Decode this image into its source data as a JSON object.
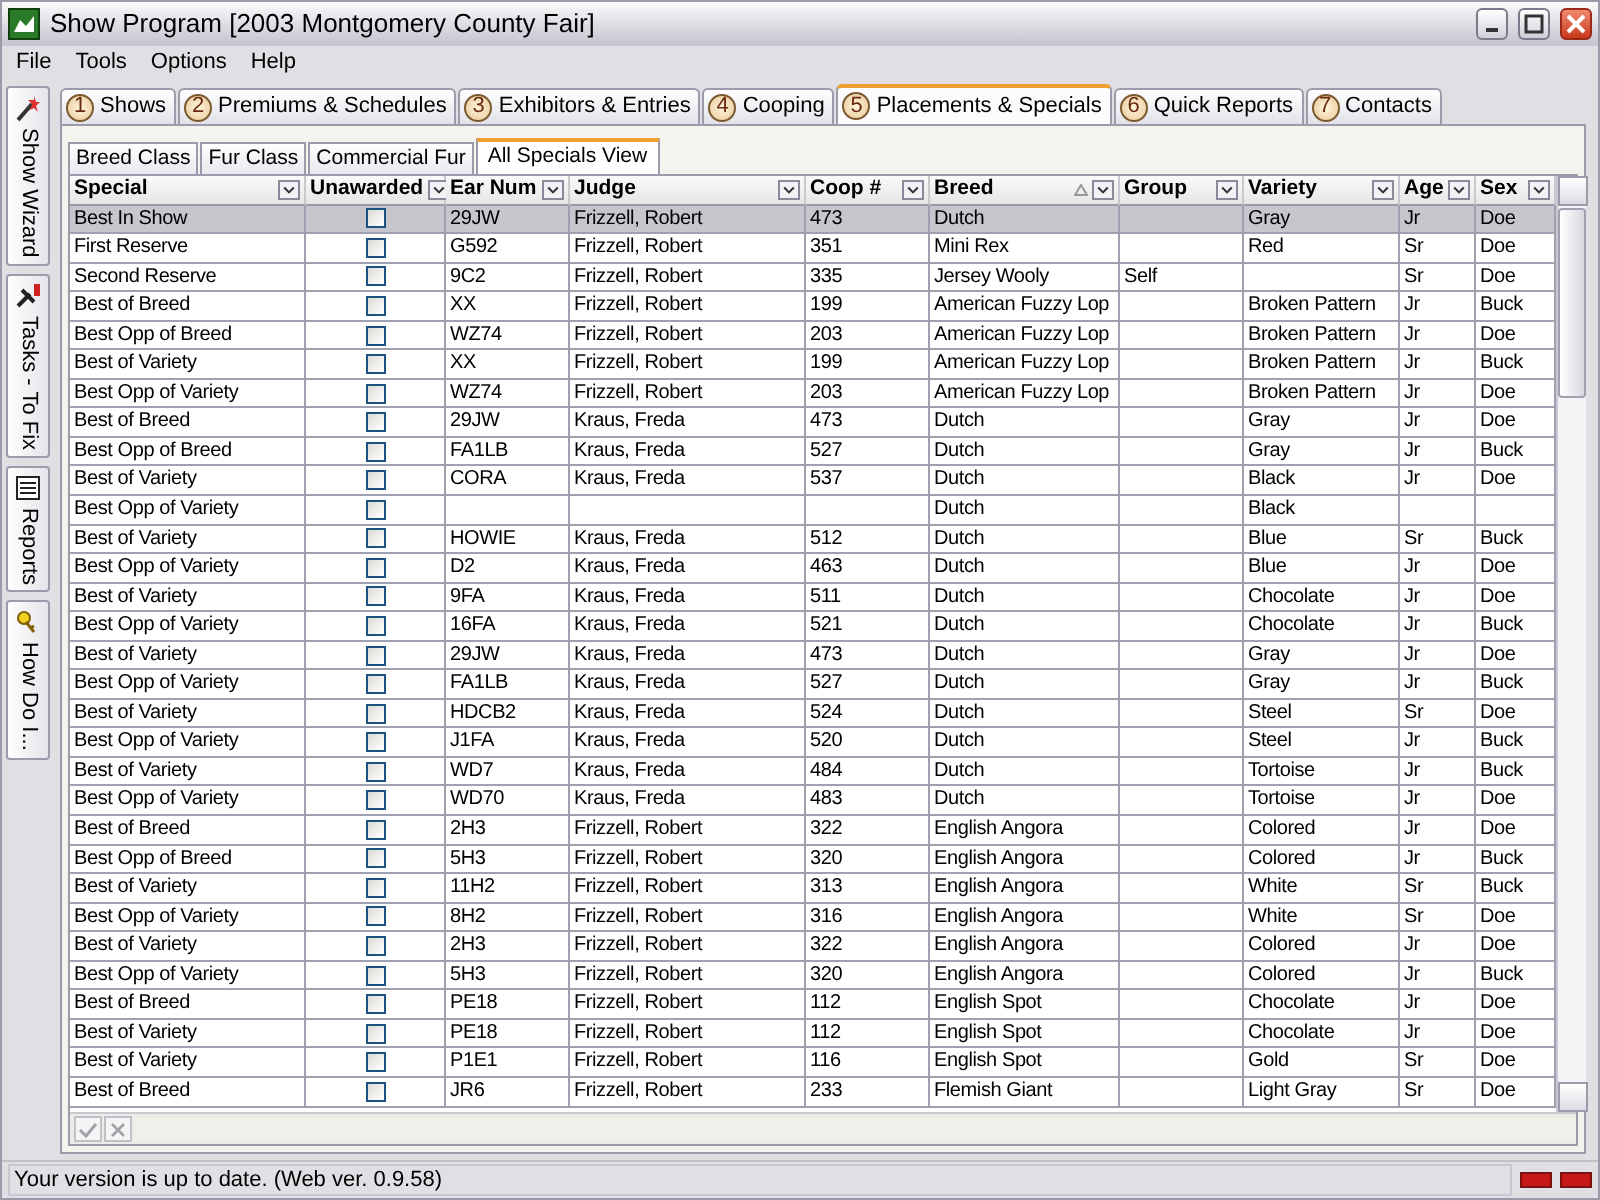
{
  "window": {
    "title": "Show Program [2003 Montgomery County Fair]"
  },
  "menu": [
    "File",
    "Tools",
    "Options",
    "Help"
  ],
  "sidebar": {
    "items": [
      {
        "label": "Show Wizard"
      },
      {
        "label": "Tasks - To Fix"
      },
      {
        "label": "Reports"
      },
      {
        "label": "How Do I..."
      }
    ]
  },
  "tabs": [
    {
      "number": "1",
      "label": "Shows",
      "selected": false
    },
    {
      "number": "2",
      "label": "Premiums & Schedules",
      "selected": false
    },
    {
      "number": "3",
      "label": "Exhibitors & Entries",
      "selected": false
    },
    {
      "number": "4",
      "label": "Cooping",
      "selected": false
    },
    {
      "number": "5",
      "label": "Placements & Specials",
      "selected": true
    },
    {
      "number": "6",
      "label": "Quick Reports",
      "selected": false
    },
    {
      "number": "7",
      "label": "Contacts",
      "selected": false
    }
  ],
  "subtabs": [
    {
      "label": "Breed Class",
      "selected": false
    },
    {
      "label": "Fur Class",
      "selected": false
    },
    {
      "label": "Commercial Fur",
      "selected": false
    },
    {
      "label": "All Specials View",
      "selected": true
    }
  ],
  "table": {
    "columns": [
      {
        "label": "Special",
        "sorted": false
      },
      {
        "label": "Unawarded",
        "sorted": false
      },
      {
        "label": "Ear Num",
        "sorted": false
      },
      {
        "label": "Judge",
        "sorted": false
      },
      {
        "label": "Coop #",
        "sorted": false
      },
      {
        "label": "Breed",
        "sorted": true
      },
      {
        "label": "Group",
        "sorted": false
      },
      {
        "label": "Variety",
        "sorted": false
      },
      {
        "label": "Age",
        "sorted": false
      },
      {
        "label": "Sex",
        "sorted": false
      }
    ],
    "rows": [
      {
        "selected": true,
        "unawarded": false,
        "cells": [
          "Best In Show",
          "",
          "29JW",
          "Frizzell, Robert",
          "473",
          "Dutch",
          "",
          "Gray",
          "Jr",
          "Doe"
        ]
      },
      {
        "selected": false,
        "unawarded": false,
        "cells": [
          "First Reserve",
          "",
          "G592",
          "Frizzell, Robert",
          "351",
          "Mini Rex",
          "",
          "Red",
          "Sr",
          "Doe"
        ]
      },
      {
        "selected": false,
        "unawarded": false,
        "cells": [
          "Second Reserve",
          "",
          "9C2",
          "Frizzell, Robert",
          "335",
          "Jersey Wooly",
          "Self",
          "",
          "Sr",
          "Doe"
        ]
      },
      {
        "selected": false,
        "unawarded": false,
        "cells": [
          "Best of Breed",
          "",
          "XX",
          "Frizzell, Robert",
          "199",
          "American Fuzzy Lop",
          "",
          "Broken Pattern",
          "Jr",
          "Buck"
        ]
      },
      {
        "selected": false,
        "unawarded": false,
        "cells": [
          "Best Opp of Breed",
          "",
          "WZ74",
          "Frizzell, Robert",
          "203",
          "American Fuzzy Lop",
          "",
          "Broken Pattern",
          "Jr",
          "Doe"
        ]
      },
      {
        "selected": false,
        "unawarded": false,
        "cells": [
          "Best of Variety",
          "",
          "XX",
          "Frizzell, Robert",
          "199",
          "American Fuzzy Lop",
          "",
          "Broken Pattern",
          "Jr",
          "Buck"
        ]
      },
      {
        "selected": false,
        "unawarded": false,
        "cells": [
          "Best Opp of Variety",
          "",
          "WZ74",
          "Frizzell, Robert",
          "203",
          "American Fuzzy Lop",
          "",
          "Broken Pattern",
          "Jr",
          "Doe"
        ]
      },
      {
        "selected": false,
        "unawarded": false,
        "cells": [
          "Best of Breed",
          "",
          "29JW",
          "Kraus, Freda",
          "473",
          "Dutch",
          "",
          "Gray",
          "Jr",
          "Doe"
        ]
      },
      {
        "selected": false,
        "unawarded": false,
        "cells": [
          "Best Opp of Breed",
          "",
          "FA1LB",
          "Kraus, Freda",
          "527",
          "Dutch",
          "",
          "Gray",
          "Jr",
          "Buck"
        ]
      },
      {
        "selected": false,
        "unawarded": false,
        "cells": [
          "Best of Variety",
          "",
          "CORA",
          "Kraus, Freda",
          "537",
          "Dutch",
          "",
          "Black",
          "Jr",
          "Doe"
        ]
      },
      {
        "selected": false,
        "unawarded": false,
        "cells": [
          "Best Opp of Variety",
          "",
          "",
          "",
          "",
          "Dutch",
          "",
          "Black",
          "",
          ""
        ]
      },
      {
        "selected": false,
        "unawarded": false,
        "cells": [
          "Best of Variety",
          "",
          "HOWIE",
          "Kraus, Freda",
          "512",
          "Dutch",
          "",
          "Blue",
          "Sr",
          "Buck"
        ]
      },
      {
        "selected": false,
        "unawarded": false,
        "cells": [
          "Best Opp of Variety",
          "",
          "D2",
          "Kraus, Freda",
          "463",
          "Dutch",
          "",
          "Blue",
          "Jr",
          "Doe"
        ]
      },
      {
        "selected": false,
        "unawarded": false,
        "cells": [
          "Best of Variety",
          "",
          "9FA",
          "Kraus, Freda",
          "511",
          "Dutch",
          "",
          "Chocolate",
          "Jr",
          "Doe"
        ]
      },
      {
        "selected": false,
        "unawarded": false,
        "cells": [
          "Best Opp of Variety",
          "",
          "16FA",
          "Kraus, Freda",
          "521",
          "Dutch",
          "",
          "Chocolate",
          "Jr",
          "Buck"
        ]
      },
      {
        "selected": false,
        "unawarded": false,
        "cells": [
          "Best of Variety",
          "",
          "29JW",
          "Kraus, Freda",
          "473",
          "Dutch",
          "",
          "Gray",
          "Jr",
          "Doe"
        ]
      },
      {
        "selected": false,
        "unawarded": false,
        "cells": [
          "Best Opp of Variety",
          "",
          "FA1LB",
          "Kraus, Freda",
          "527",
          "Dutch",
          "",
          "Gray",
          "Jr",
          "Buck"
        ]
      },
      {
        "selected": false,
        "unawarded": false,
        "cells": [
          "Best of Variety",
          "",
          "HDCB2",
          "Kraus, Freda",
          "524",
          "Dutch",
          "",
          "Steel",
          "Sr",
          "Doe"
        ]
      },
      {
        "selected": false,
        "unawarded": false,
        "cells": [
          "Best Opp of Variety",
          "",
          "J1FA",
          "Kraus, Freda",
          "520",
          "Dutch",
          "",
          "Steel",
          "Jr",
          "Buck"
        ]
      },
      {
        "selected": false,
        "unawarded": false,
        "cells": [
          "Best of Variety",
          "",
          "WD7",
          "Kraus, Freda",
          "484",
          "Dutch",
          "",
          "Tortoise",
          "Jr",
          "Buck"
        ]
      },
      {
        "selected": false,
        "unawarded": false,
        "cells": [
          "Best Opp of Variety",
          "",
          "WD70",
          "Kraus, Freda",
          "483",
          "Dutch",
          "",
          "Tortoise",
          "Jr",
          "Doe"
        ]
      },
      {
        "selected": false,
        "unawarded": false,
        "cells": [
          "Best of Breed",
          "",
          "2H3",
          "Frizzell, Robert",
          "322",
          "English Angora",
          "",
          "Colored",
          "Jr",
          "Doe"
        ]
      },
      {
        "selected": false,
        "unawarded": false,
        "cells": [
          "Best Opp of Breed",
          "",
          "5H3",
          "Frizzell, Robert",
          "320",
          "English Angora",
          "",
          "Colored",
          "Jr",
          "Buck"
        ]
      },
      {
        "selected": false,
        "unawarded": false,
        "cells": [
          "Best of Variety",
          "",
          "11H2",
          "Frizzell, Robert",
          "313",
          "English Angora",
          "",
          "White",
          "Sr",
          "Buck"
        ]
      },
      {
        "selected": false,
        "unawarded": false,
        "cells": [
          "Best Opp of Variety",
          "",
          "8H2",
          "Frizzell, Robert",
          "316",
          "English Angora",
          "",
          "White",
          "Sr",
          "Doe"
        ]
      },
      {
        "selected": false,
        "unawarded": false,
        "cells": [
          "Best of Variety",
          "",
          "2H3",
          "Frizzell, Robert",
          "322",
          "English Angora",
          "",
          "Colored",
          "Jr",
          "Doe"
        ]
      },
      {
        "selected": false,
        "unawarded": false,
        "cells": [
          "Best Opp of Variety",
          "",
          "5H3",
          "Frizzell, Robert",
          "320",
          "English Angora",
          "",
          "Colored",
          "Jr",
          "Buck"
        ]
      },
      {
        "selected": false,
        "unawarded": false,
        "cells": [
          "Best of Breed",
          "",
          "PE18",
          "Frizzell, Robert",
          "112",
          "English Spot",
          "",
          "Chocolate",
          "Jr",
          "Doe"
        ]
      },
      {
        "selected": false,
        "unawarded": false,
        "cells": [
          "Best of Variety",
          "",
          "PE18",
          "Frizzell, Robert",
          "112",
          "English Spot",
          "",
          "Chocolate",
          "Jr",
          "Doe"
        ]
      },
      {
        "selected": false,
        "unawarded": false,
        "cells": [
          "Best of Variety",
          "",
          "P1E1",
          "Frizzell, Robert",
          "116",
          "English Spot",
          "",
          "Gold",
          "Sr",
          "Doe"
        ]
      },
      {
        "selected": false,
        "unawarded": false,
        "cells": [
          "Best of Breed",
          "",
          "JR6",
          "Frizzell, Robert",
          "233",
          "Flemish Giant",
          "",
          "Light Gray",
          "Sr",
          "Doe"
        ]
      }
    ]
  },
  "status_bar": {
    "text": "Your version is up to date. (Web ver. 0.9.58)"
  }
}
